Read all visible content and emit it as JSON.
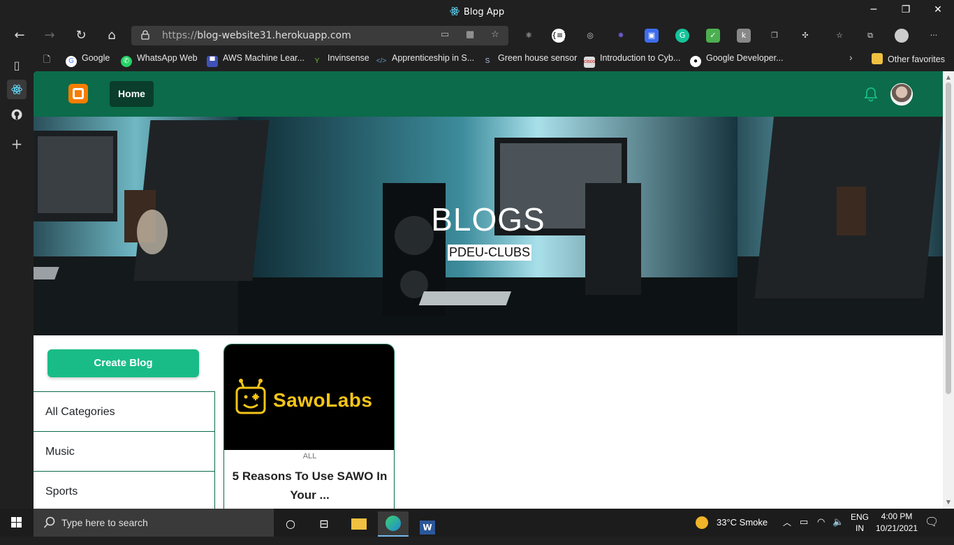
{
  "browser": {
    "window_title": "Blog App",
    "url_scheme": "https://",
    "url_host": "blog-website31.herokuapp.com"
  },
  "bookmarks": [
    {
      "label": "Google",
      "icon": "google-icon",
      "color": "#ffffff"
    },
    {
      "label": "WhatsApp Web",
      "icon": "whatsapp-icon",
      "color": "#25d366"
    },
    {
      "label": "AWS Machine Lear...",
      "icon": "aws-icon",
      "color": "#3f51b5"
    },
    {
      "label": "Invinsense",
      "icon": "invinsense-icon",
      "color": "#6dbf3a"
    },
    {
      "label": "Apprenticeship in S...",
      "icon": "code-icon",
      "color": "#5b9bd5"
    },
    {
      "label": "Green house sensor",
      "icon": "s-icon",
      "color": "#4a5a8a"
    },
    {
      "label": "Introduction to Cyb...",
      "icon": "cisco-icon",
      "color": "#d0d0d0"
    },
    {
      "label": "Google Developer...",
      "icon": "github-icon",
      "color": "#ffffff"
    },
    {
      "label": "Other favorites",
      "icon": "folder-icon",
      "color": "#f0c040"
    }
  ],
  "app": {
    "nav_home": "Home",
    "hero_title": "BLOGS",
    "hero_subtitle": "PDEU-CLUBS",
    "create_button": "Create Blog",
    "categories": [
      "All Categories",
      "Music",
      "Sports"
    ],
    "card": {
      "image_brand": "SawoLabs",
      "category": "ALL",
      "title": "5 Reasons To Use SAWO In Your ..."
    },
    "colors": {
      "nav": "#0b6b4a",
      "accent": "#19bc87"
    }
  },
  "taskbar": {
    "search_placeholder": "Type here to search",
    "weather": "33°C  Smoke",
    "lang_top": "ENG",
    "lang_bottom": "IN",
    "time": "4:00 PM",
    "date": "10/21/2021"
  }
}
